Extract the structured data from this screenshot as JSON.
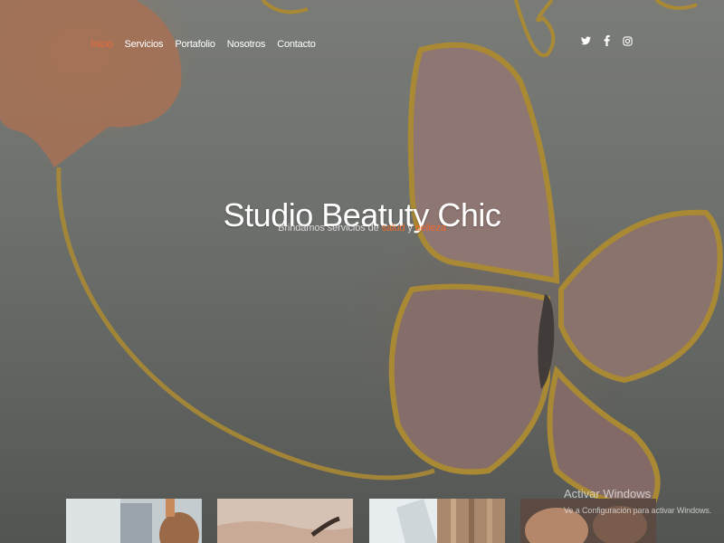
{
  "nav": {
    "items": [
      {
        "label": "Inicio",
        "active": true
      },
      {
        "label": "Servicios"
      },
      {
        "label": "Portafolio"
      },
      {
        "label": "Nosotros"
      },
      {
        "label": "Contacto"
      }
    ]
  },
  "social": {
    "icons": [
      "twitter-icon",
      "facebook-icon",
      "instagram-icon"
    ]
  },
  "hero": {
    "title": "Studio Beatuty Chic",
    "subtitle_prefix": "Brindamos servicios de ",
    "subtitle_word1": "salud",
    "subtitle_join": " y ",
    "subtitle_word2": "belleza"
  },
  "windows_watermark": {
    "title": "Activar Windows",
    "subtitle": "Ve a Configuración para activar Windows."
  },
  "colors": {
    "accent": "#e8693a",
    "text": "#ffffff",
    "muted": "#d9d9d9"
  }
}
